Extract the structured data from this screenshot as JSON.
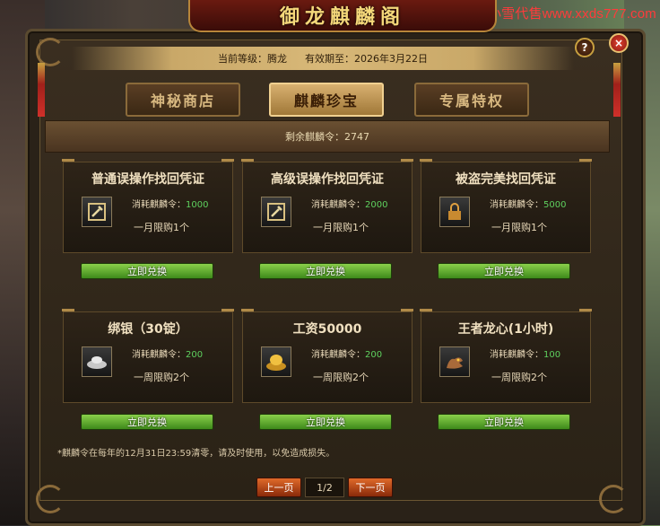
{
  "watermark": "小雪代售www.xxds777.com",
  "window": {
    "title": "御龙麒麟阁"
  },
  "header": {
    "level_label": "当前等级：腾龙",
    "expiry_label": "有效期至：2026年3月22日"
  },
  "controls": {
    "help": "?",
    "close": "×"
  },
  "tabs": [
    {
      "label": "神秘商店",
      "active": false
    },
    {
      "label": "麒麟珍宝",
      "active": true
    },
    {
      "label": "专属特权",
      "active": false
    }
  ],
  "remaining": "剩余麒麟令：2747",
  "cost_prefix": "消耗麒麟令：",
  "items": [
    {
      "name": "普通误操作找回凭证",
      "cost": "1000",
      "limit": "一月限购1个",
      "icon": "wrench-icon"
    },
    {
      "name": "高级误操作找回凭证",
      "cost": "2000",
      "limit": "一月限购1个",
      "icon": "wrench-icon"
    },
    {
      "name": "被盗完美找回凭证",
      "cost": "5000",
      "limit": "一月限购1个",
      "icon": "lock-icon"
    },
    {
      "name": "绑银（30锭）",
      "cost": "200",
      "limit": "一周限购2个",
      "icon": "silver-ingot-icon"
    },
    {
      "name": "工资50000",
      "cost": "200",
      "limit": "一周限购2个",
      "icon": "gold-ingot-icon"
    },
    {
      "name": "王者龙心(1小时)",
      "cost": "100",
      "limit": "一周限购2个",
      "icon": "dragon-icon"
    }
  ],
  "redeem_label": "立即兑换",
  "notice": "*麒麟令在每年的12月31日23:59清零，请及时使用，以免造成损失。",
  "pager": {
    "prev": "上一页",
    "page": "1/2",
    "next": "下一页"
  },
  "colors": {
    "accent_gold": "#d8b070",
    "button_green": "#5aa82a",
    "pager_orange": "#c8501a",
    "cost_green": "#5ed05e"
  }
}
